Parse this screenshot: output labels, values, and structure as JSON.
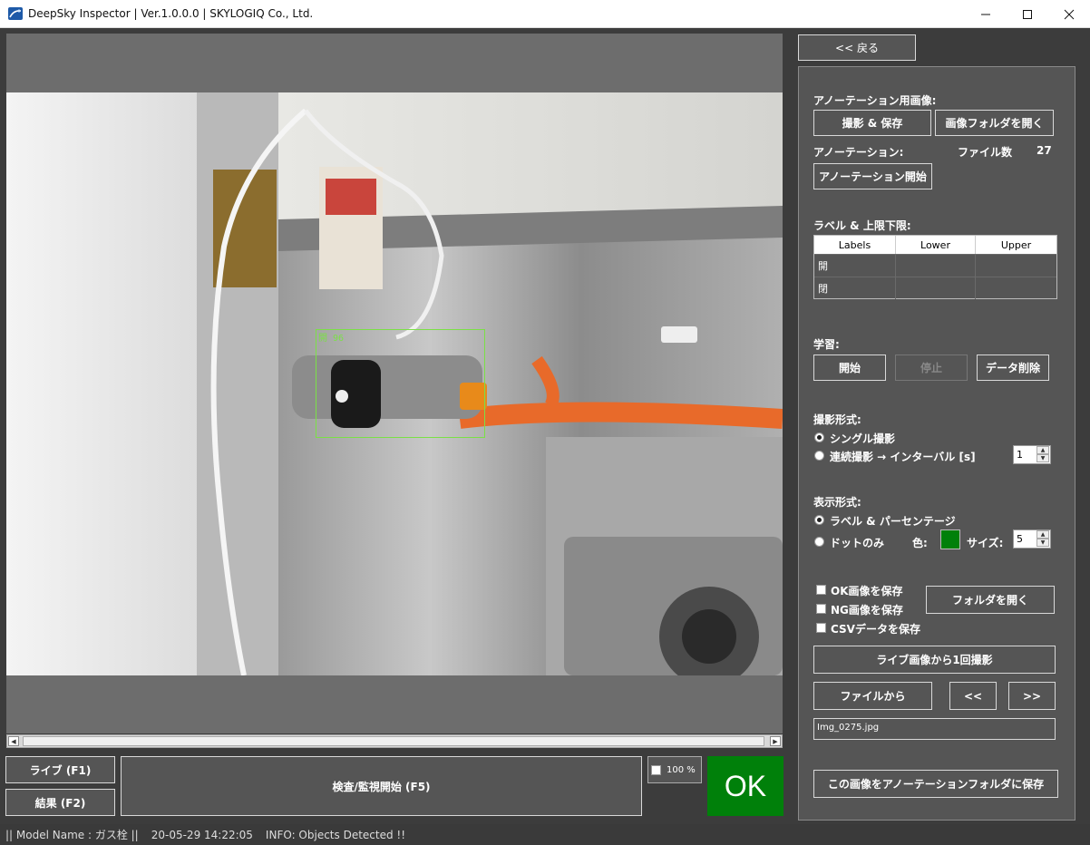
{
  "window": {
    "title": "DeepSky Inspector | Ver.1.0.0.0 | SKYLOGIQ Co., Ltd."
  },
  "detection": {
    "box_label": "開 96",
    "box_color": "#7be046"
  },
  "bottom": {
    "live_button": "ライブ (F1)",
    "result_button": "結果 (F2)",
    "inspect_button": "検査/監視開始 (F5)",
    "zoom_label": "100 %",
    "ok_label": "OK",
    "ok_color": "#00800a"
  },
  "right": {
    "back_button": "<< 戻る",
    "annotation_images_label": "アノーテーション用画像:",
    "capture_save_button": "撮影 & 保存",
    "open_image_folder_button": "画像フォルダを開く",
    "annotation_label": "アノーテーション:",
    "file_count_label": "ファイル数",
    "file_count_value": "27",
    "annotation_start_button": "アノーテーション開始",
    "labels_limits_label": "ラベル & 上限下限:",
    "table": {
      "headers": [
        "Labels",
        "Lower",
        "Upper"
      ],
      "rows": [
        [
          "開",
          "",
          ""
        ],
        [
          "閉",
          "",
          ""
        ]
      ]
    },
    "learning_label": "学習:",
    "learn_start_button": "開始",
    "learn_stop_button": "停止",
    "data_delete_button": "データ削除",
    "capture_mode_label": "撮影形式:",
    "single_capture": "シングル撮影",
    "continuous_capture": "連続撮影 → インターバル [s]",
    "interval_value": "1",
    "display_mode_label": "表示形式:",
    "label_percentage": "ラベル & パーセンテージ",
    "dot_only": "ドットのみ",
    "color_label": "色:",
    "color_value": "#00800a",
    "size_label": "サイズ:",
    "size_value": "5",
    "save_ok_images": "OK画像を保存",
    "save_ng_images": "NG画像を保存",
    "save_csv": "CSVデータを保存",
    "open_folder_button": "フォルダを開く",
    "capture_once_button": "ライブ画像から1回撮影",
    "from_file_button": "ファイルから",
    "prev_button": "<<",
    "next_button": ">>",
    "file_name": "Img_0275.jpg",
    "save_to_annotation_button": "この画像をアノーテーションフォルダに保存"
  },
  "status": {
    "model": "|| Model Name : ガス栓 ||",
    "timestamp": "20-05-29 14:22:05",
    "info": "INFO:   Objects Detected !!"
  }
}
